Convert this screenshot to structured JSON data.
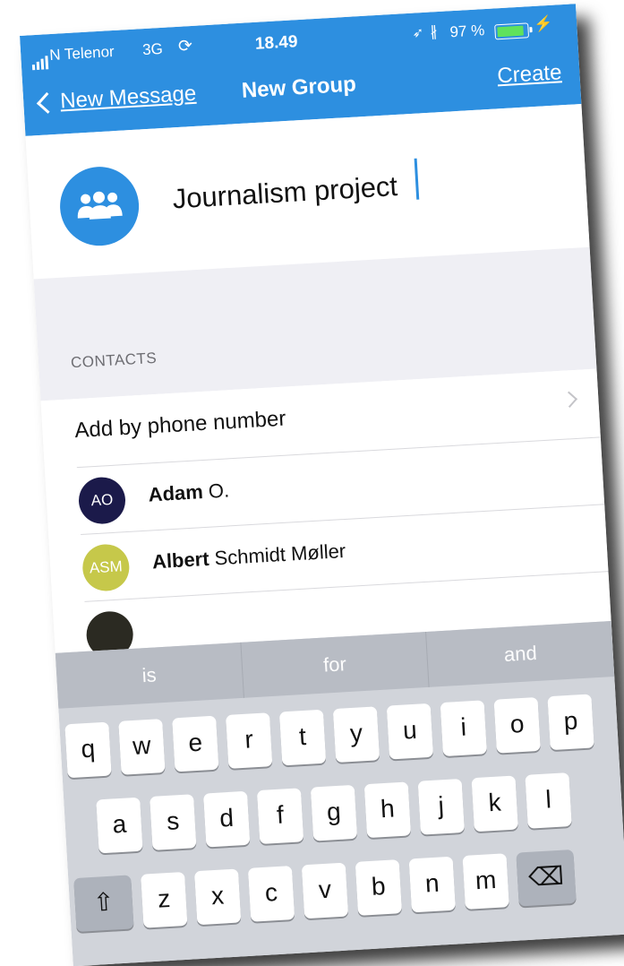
{
  "status_bar": {
    "carrier": "N Telenor",
    "network": "3G",
    "sync_glyph": "⟳",
    "time": "18.49",
    "location_glyph": "➶",
    "bluetooth_glyph": "∦",
    "battery_percent_label": "97 %",
    "battery_level": 0.97,
    "charging_glyph": "⚡"
  },
  "nav": {
    "back_label": "New Message",
    "title": "New Group",
    "action_label": "Create"
  },
  "group": {
    "name_value": "Journalism project",
    "icon": "group-icon"
  },
  "contacts": {
    "section_header": "CONTACTS",
    "add_by_phone_label": "Add by phone number",
    "items": [
      {
        "initials": "AO",
        "first": "Adam",
        "last": "O.",
        "color": "#1b1a4a"
      },
      {
        "initials": "ASM",
        "first": "Albert",
        "last": "Schmidt Møller",
        "color": "#c6c84a"
      }
    ],
    "partial_avatar_color": "#2b2a22"
  },
  "keyboard": {
    "suggestions": [
      "is",
      "for",
      "and"
    ],
    "row1": [
      "q",
      "w",
      "e",
      "r",
      "t",
      "y",
      "u",
      "i",
      "o",
      "p"
    ],
    "row2": [
      "a",
      "s",
      "d",
      "f",
      "g",
      "h",
      "j",
      "k",
      "l"
    ],
    "row3": [
      "z",
      "x",
      "c",
      "v",
      "b",
      "n",
      "m"
    ],
    "shift_glyph": "⇧",
    "delete_glyph": "⌫"
  },
  "colors": {
    "accent": "#2d8fe0",
    "background_gray": "#efeff4",
    "keyboard_bg": "#d1d4da"
  }
}
